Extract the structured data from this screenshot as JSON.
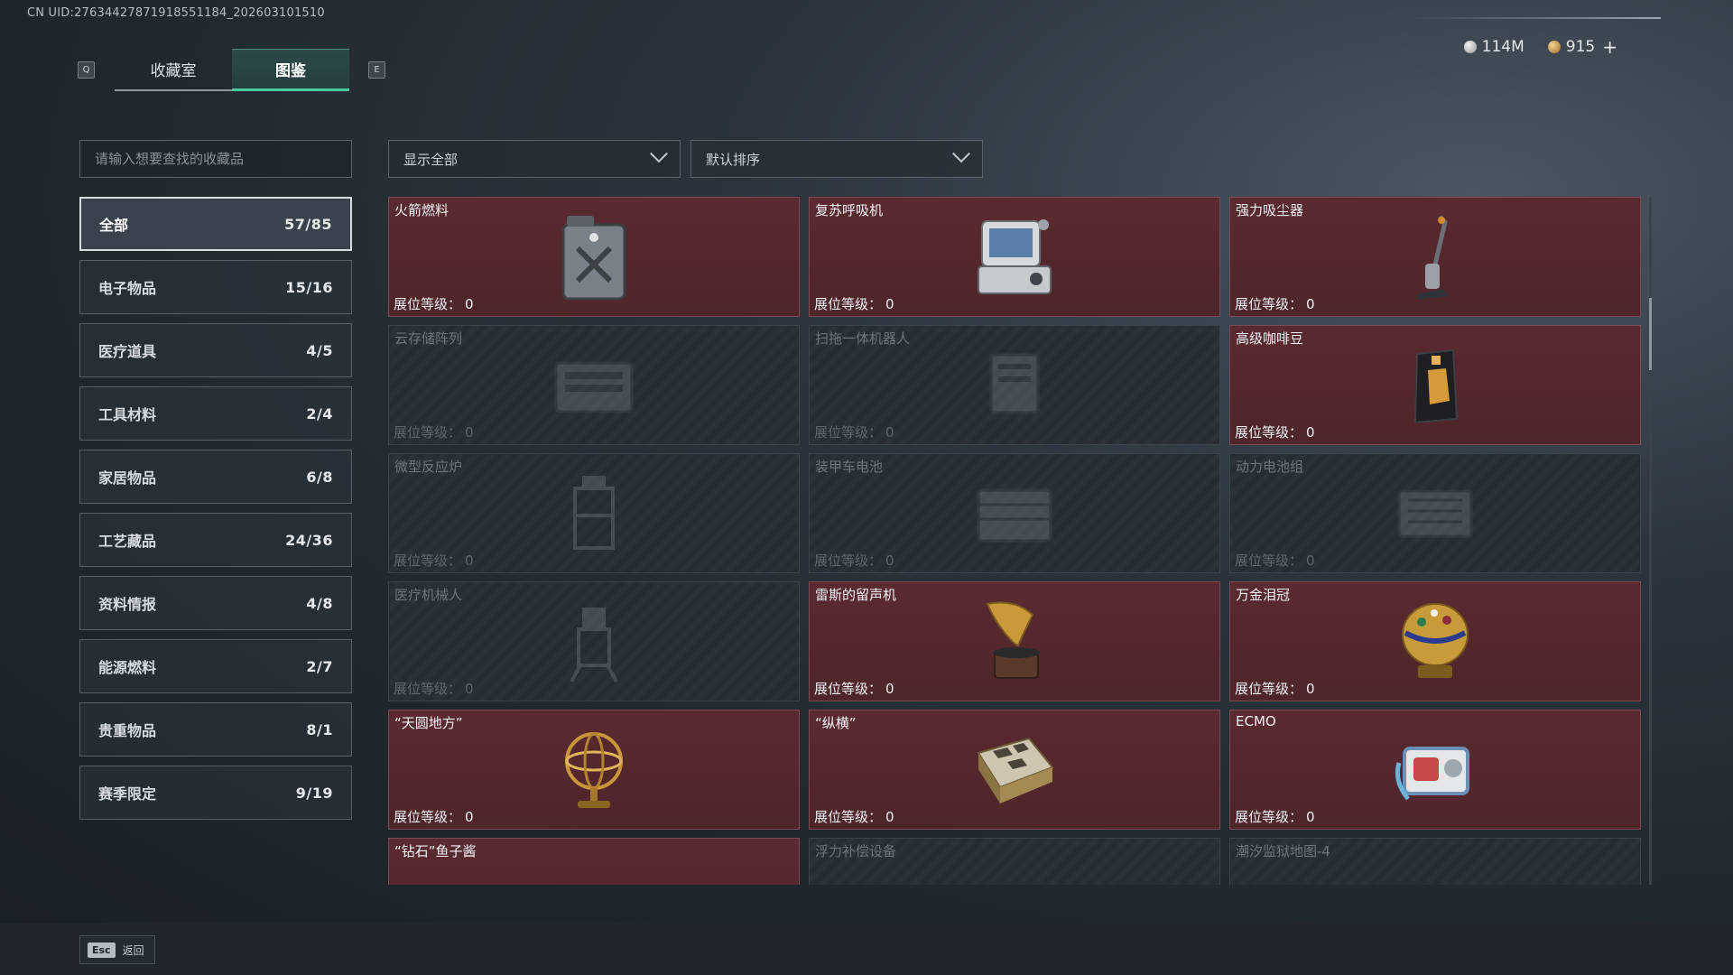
{
  "uid": "CN UID:27634427871918551184_202603101510",
  "tabs": {
    "key_left": "Q",
    "key_right": "E",
    "collection_room": "收藏室",
    "codex": "图鉴"
  },
  "currency": {
    "silver": "114M",
    "gold": "915",
    "plus": "+"
  },
  "search": {
    "placeholder": "请输入想要查找的收藏品"
  },
  "filters": {
    "show": "显示全部",
    "sort": "默认排序"
  },
  "categories": [
    {
      "label": "全部",
      "count": "57/85"
    },
    {
      "label": "电子物品",
      "count": "15/16"
    },
    {
      "label": "医疗道具",
      "count": "4/5"
    },
    {
      "label": "工具材料",
      "count": "2/4"
    },
    {
      "label": "家居物品",
      "count": "6/8"
    },
    {
      "label": "工艺藏品",
      "count": "24/36"
    },
    {
      "label": "资料情报",
      "count": "4/8"
    },
    {
      "label": "能源燃料",
      "count": "2/7"
    },
    {
      "label": "贵重物品",
      "count": "8/1"
    },
    {
      "label": "赛季限定",
      "count": "9/19"
    }
  ],
  "level_label": "展位等级：",
  "items": [
    {
      "name": "火箭燃料",
      "level": "0",
      "owned": true,
      "icon": "fuel-can-icon"
    },
    {
      "name": "复苏呼吸机",
      "level": "0",
      "owned": true,
      "icon": "ventilator-icon"
    },
    {
      "name": "强力吸尘器",
      "level": "0",
      "owned": true,
      "icon": "vacuum-icon"
    },
    {
      "name": "云存储阵列",
      "level": "0",
      "owned": false,
      "icon": "storage-array-icon"
    },
    {
      "name": "扫拖一体机器人",
      "level": "0",
      "owned": false,
      "icon": "robot-vacuum-icon"
    },
    {
      "name": "高级咖啡豆",
      "level": "0",
      "owned": true,
      "icon": "coffee-bag-icon"
    },
    {
      "name": "微型反应炉",
      "level": "0",
      "owned": false,
      "icon": "reactor-icon"
    },
    {
      "name": "装甲车电池",
      "level": "0",
      "owned": false,
      "icon": "battery-icon"
    },
    {
      "name": "动力电池组",
      "level": "0",
      "owned": false,
      "icon": "battery-pack-icon"
    },
    {
      "name": "医疗机械人",
      "level": "0",
      "owned": false,
      "icon": "medical-robot-icon"
    },
    {
      "name": "雷斯的留声机",
      "level": "0",
      "owned": true,
      "icon": "gramophone-icon"
    },
    {
      "name": "万金泪冠",
      "level": "0",
      "owned": true,
      "icon": "jeweled-egg-icon"
    },
    {
      "name": "“天圆地方”",
      "level": "0",
      "owned": true,
      "icon": "armillary-sphere-icon"
    },
    {
      "name": "“纵横”",
      "level": "0",
      "owned": true,
      "icon": "chess-box-icon"
    },
    {
      "name": "ECMO",
      "level": "0",
      "owned": true,
      "icon": "ecmo-icon"
    },
    {
      "name": "“钻石”鱼子酱",
      "level": "",
      "owned": true,
      "icon": "caviar-tin-icon"
    },
    {
      "name": "浮力补偿设备",
      "level": "",
      "owned": false,
      "icon": "buoyancy-device-icon"
    },
    {
      "name": "潮汐监狱地图-4",
      "level": "",
      "owned": false,
      "icon": "map-icon"
    }
  ],
  "footer": {
    "esc_key": "Esc",
    "back": "返回"
  },
  "colors": {
    "accent": "#48c9a0",
    "owned_card": "#5a2a30",
    "locked_card": "#262d34"
  }
}
